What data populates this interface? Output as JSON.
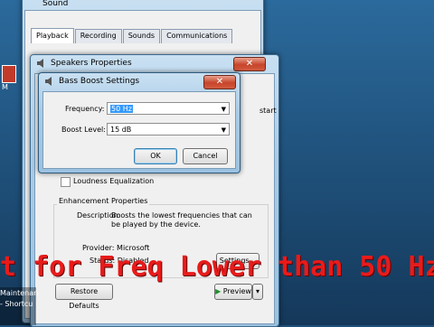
{
  "sound_window": {
    "title": "Sound",
    "tabs": [
      "Playback",
      "Recording",
      "Sounds",
      "Communications"
    ],
    "active_tab": "Playback"
  },
  "speakers_window": {
    "title": "Speakers Properties",
    "partial_text": "start",
    "loudness_label": "Loudness Equalization",
    "enhancement_title": "Enhancement Properties",
    "description_label": "Description:",
    "description_text": "Boosts the lowest frequencies that can be played by the device.",
    "provider": "Provider: Microsoft",
    "status": "Status: Disabled",
    "settings_button": "Settings...",
    "restore_button": "Restore Defaults",
    "preview_button": "Preview"
  },
  "bass_dialog": {
    "title": "Bass Boost Settings",
    "frequency_label": "Frequency:",
    "frequency_value": "50 Hz",
    "boost_label": "Boost Level:",
    "boost_value": "15 dB",
    "ok_button": "OK",
    "cancel_button": "Cancel"
  },
  "overlay": {
    "text": "t for Freq Lower than 50 Hz"
  },
  "desktop": {
    "icon_label": "M",
    "taskbar_items": [
      "Maintenan",
      "- Shortcu"
    ]
  }
}
